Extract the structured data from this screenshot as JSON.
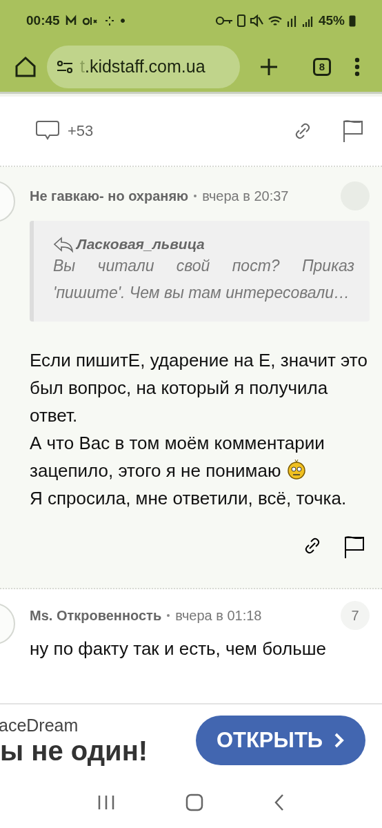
{
  "status_bar": {
    "time": "00:45",
    "battery": "45%"
  },
  "browser": {
    "url_faded": "t",
    "url": ".kidstaff.com.ua",
    "tab_count": "8"
  },
  "post_actions": {
    "comment_count": "+53"
  },
  "comments": [
    {
      "author": "Не гавкаю- но охраняю",
      "time": "вчера в 20:37",
      "quote": {
        "author": "Ласковая_львица",
        "text": "Вы читали свой пост? Приказ 'пишите'. Чем вы там интересовали…"
      },
      "paragraphs": [
        {
          "text": "Если пишитЕ, ударение на Е, значит это был вопрос, на который я получила ответ.",
          "smiley": false
        },
        {
          "text": "А что Вас в том моём комментарии зацепило, этого я не понимаю",
          "smiley": true
        },
        {
          "text": "Я спросила, мне ответили, всё, точка.",
          "smiley": false
        }
      ]
    },
    {
      "author": "Ms. Откровенность",
      "time": "вчера в 01:18",
      "badge": "7",
      "paragraphs": [
        {
          "text": "ну по факту так и есть, чем больше",
          "smiley": false
        }
      ]
    }
  ],
  "ad": {
    "brand": "aceDream",
    "headline": "ы не один!",
    "button": "ОТКРЫТЬ"
  }
}
